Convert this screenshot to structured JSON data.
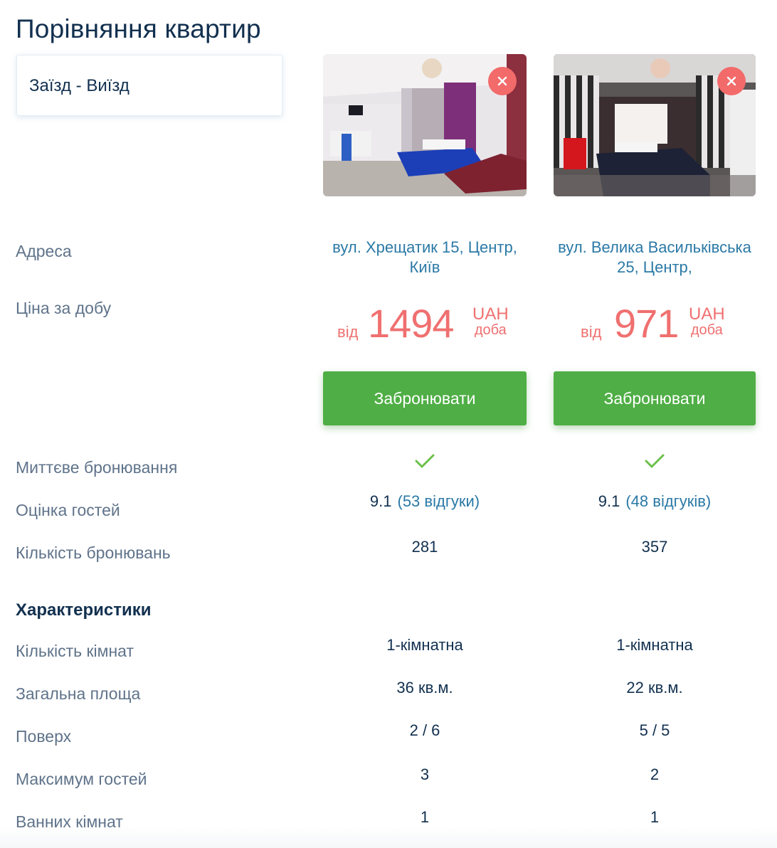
{
  "page": {
    "title": "Порівняння квартир",
    "date_range_placeholder": "Заїзд - Виїзд"
  },
  "labels": {
    "address": "Адреса",
    "price": "Ціна за добу",
    "instant": "Миттєве бронювання",
    "rating": "Оцінка гостей",
    "bookings": "Кількість бронювань",
    "section_characteristics": "Характеристики",
    "rooms": "Кількість кімнат",
    "area": "Загальна площа",
    "floor": "Поверх",
    "max_guests": "Максимум гостей",
    "bathrooms": "Ванних кімнат"
  },
  "apartments": [
    {
      "address": "вул. Хрещатик 15, Центр, Київ",
      "price_from": "від",
      "price": "1494",
      "currency": "UAH",
      "per": "доба",
      "book_label": "Забронювати",
      "instant_booking": true,
      "rating": "9.1",
      "reviews": "(53 відгуки)",
      "bookings": "281",
      "rooms": "1-кімнатна",
      "area": "36 кв.м.",
      "floor": "2 / 6",
      "max_guests": "3",
      "bathrooms": "1"
    },
    {
      "address": "вул. Велика Васильківська 25, Центр,",
      "price_from": "від",
      "price": "971",
      "currency": "UAH",
      "per": "доба",
      "book_label": "Забронювати",
      "instant_booking": true,
      "rating": "9.1",
      "reviews": "(48 відгуків)",
      "bookings": "357",
      "rooms": "1-кімнатна",
      "area": "22 кв.м.",
      "floor": "5 / 5",
      "max_guests": "2",
      "bathrooms": "1"
    }
  ],
  "colors": {
    "accent_green": "#4fae45",
    "price_red": "#f07070",
    "link_blue": "#2b79a6",
    "remove_red": "#f26a6a"
  }
}
